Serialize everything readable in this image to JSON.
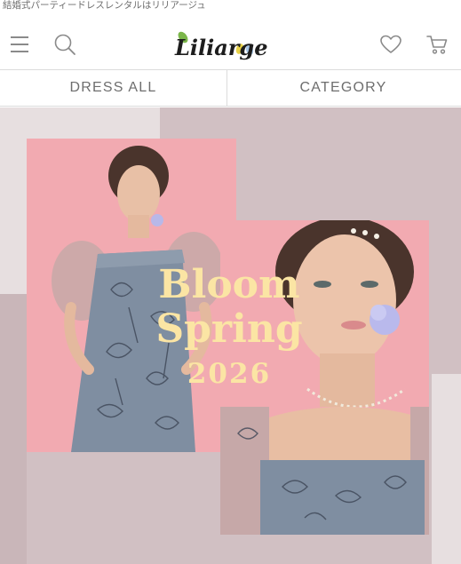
{
  "site": {
    "tagline": "結婚式パーティードレスレンタルはリリアージュ",
    "logo_text": "Liliarge"
  },
  "header": {
    "icons": [
      "menu-icon",
      "search-icon",
      "heart-icon",
      "cart-icon"
    ]
  },
  "nav": {
    "tabs": [
      {
        "label": "DRESS ALL"
      },
      {
        "label": "CATEGORY"
      }
    ]
  },
  "hero": {
    "line1": "Bloom",
    "line2": "Spring",
    "line3": "2026"
  },
  "colors": {
    "hero_bg": "#d1c0c3",
    "photo_pink": "#f2aab1",
    "headline": "#fbe5a4",
    "dress_blue": "#7f8ea1",
    "text_gray": "#6e6e6e"
  }
}
